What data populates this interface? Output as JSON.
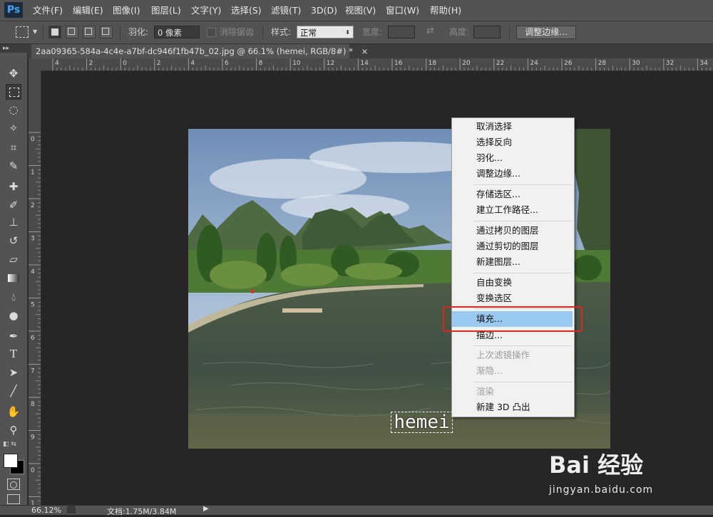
{
  "app": {
    "logo": "Ps"
  },
  "menu": [
    "文件(F)",
    "编辑(E)",
    "图像(I)",
    "图层(L)",
    "文字(Y)",
    "选择(S)",
    "滤镜(T)",
    "3D(D)",
    "视图(V)",
    "窗口(W)",
    "帮助(H)"
  ],
  "options": {
    "feather_label": "羽化:",
    "feather_value": "0 像素",
    "antialias_label": "消除锯齿",
    "style_label": "样式:",
    "style_value": "正常",
    "width_label": "宽度:",
    "height_label": "高度:",
    "refine_button": "调整边缘..."
  },
  "document": {
    "tab_title": "2aa09365-584a-4c4e-a7bf-dc946f1fb47b_02.jpg @ 66.1% (hemei, RGB/8#) *",
    "close_symbol": "×",
    "text_layer": "hemei"
  },
  "rulers": {
    "top": [
      "4",
      "2",
      "0",
      "2",
      "4",
      "6",
      "8",
      "10",
      "12",
      "14",
      "16",
      "18",
      "20",
      "22",
      "24",
      "26",
      "28",
      "30",
      "32",
      "34"
    ],
    "left": [
      "0",
      "1",
      "2",
      "3",
      "4",
      "5",
      "6",
      "7",
      "8",
      "9",
      "0",
      "1"
    ]
  },
  "context_menu": {
    "items": [
      {
        "label": "取消选择",
        "disabled": false
      },
      {
        "label": "选择反向",
        "disabled": false
      },
      {
        "label": "羽化...",
        "disabled": false
      },
      {
        "label": "调整边缘...",
        "disabled": false
      },
      {
        "label": "存储选区...",
        "disabled": false
      },
      {
        "label": "建立工作路径...",
        "disabled": false
      },
      {
        "label": "通过拷贝的图层",
        "disabled": false
      },
      {
        "label": "通过剪切的图层",
        "disabled": false
      },
      {
        "label": "新建图层...",
        "disabled": false
      },
      {
        "label": "自由变换",
        "disabled": false
      },
      {
        "label": "变换选区",
        "disabled": false
      },
      {
        "label": "填充...",
        "disabled": false,
        "highlighted": true
      },
      {
        "label": "描边...",
        "disabled": false
      },
      {
        "label": "上次滤镜操作",
        "disabled": true
      },
      {
        "label": "渐隐...",
        "disabled": true
      },
      {
        "label": "渲染",
        "disabled": true
      },
      {
        "label": "新建 3D 凸出",
        "disabled": false
      }
    ]
  },
  "status": {
    "zoom": "66.12%",
    "doc_info": "文档:1.75M/3.84M"
  },
  "watermark": {
    "logo": "Bai 经验",
    "url": "jingyan.baidu.com"
  },
  "colors": {
    "highlight_outline": "#e3261d",
    "menu_highlight": "#99c9ef"
  }
}
